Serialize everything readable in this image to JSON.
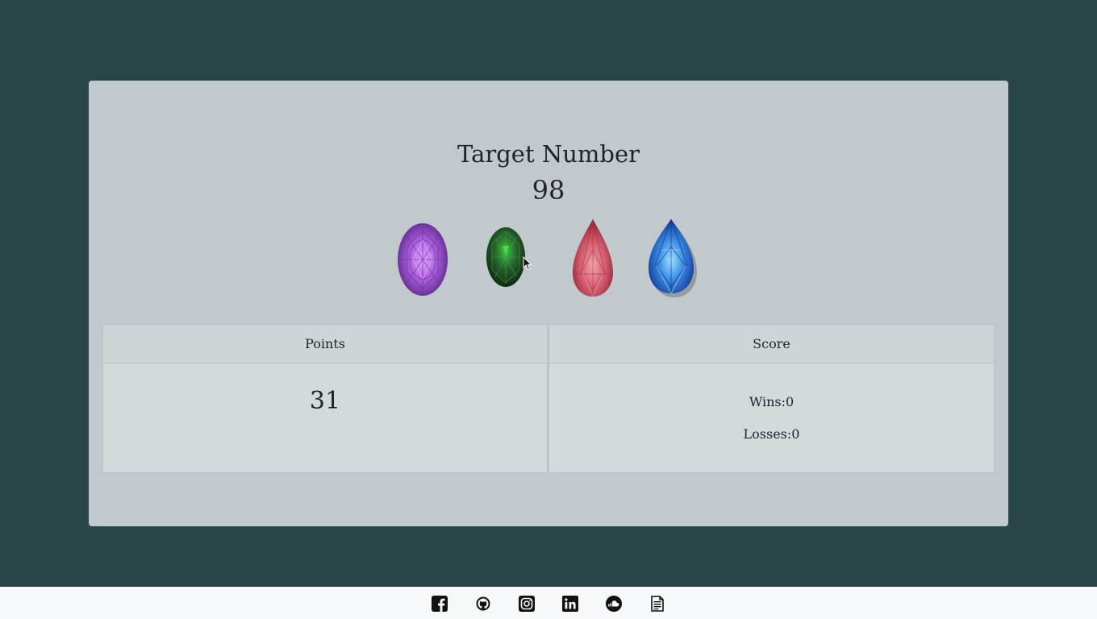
{
  "game": {
    "target_title": "Target Number",
    "target_value": "98",
    "crystals": [
      {
        "name": "purple-crystal",
        "color": "#a65ad6"
      },
      {
        "name": "green-crystal",
        "color": "#2a6a2a"
      },
      {
        "name": "red-crystal",
        "color": "#d2586a"
      },
      {
        "name": "blue-crystal",
        "color": "#2a6ad8"
      }
    ]
  },
  "points": {
    "header": "Points",
    "value": "31"
  },
  "score": {
    "header": "Score",
    "wins": "Wins:0",
    "losses": "Losses:0"
  },
  "footer": {
    "icons": [
      "facebook-icon",
      "github-icon",
      "instagram-icon",
      "linkedin-icon",
      "soundcloud-icon",
      "resume-icon"
    ]
  },
  "colors": {
    "background": "#284547",
    "panel": "#c1c9cc",
    "card": "#d3dadb",
    "footer": "#f7f8f9"
  }
}
